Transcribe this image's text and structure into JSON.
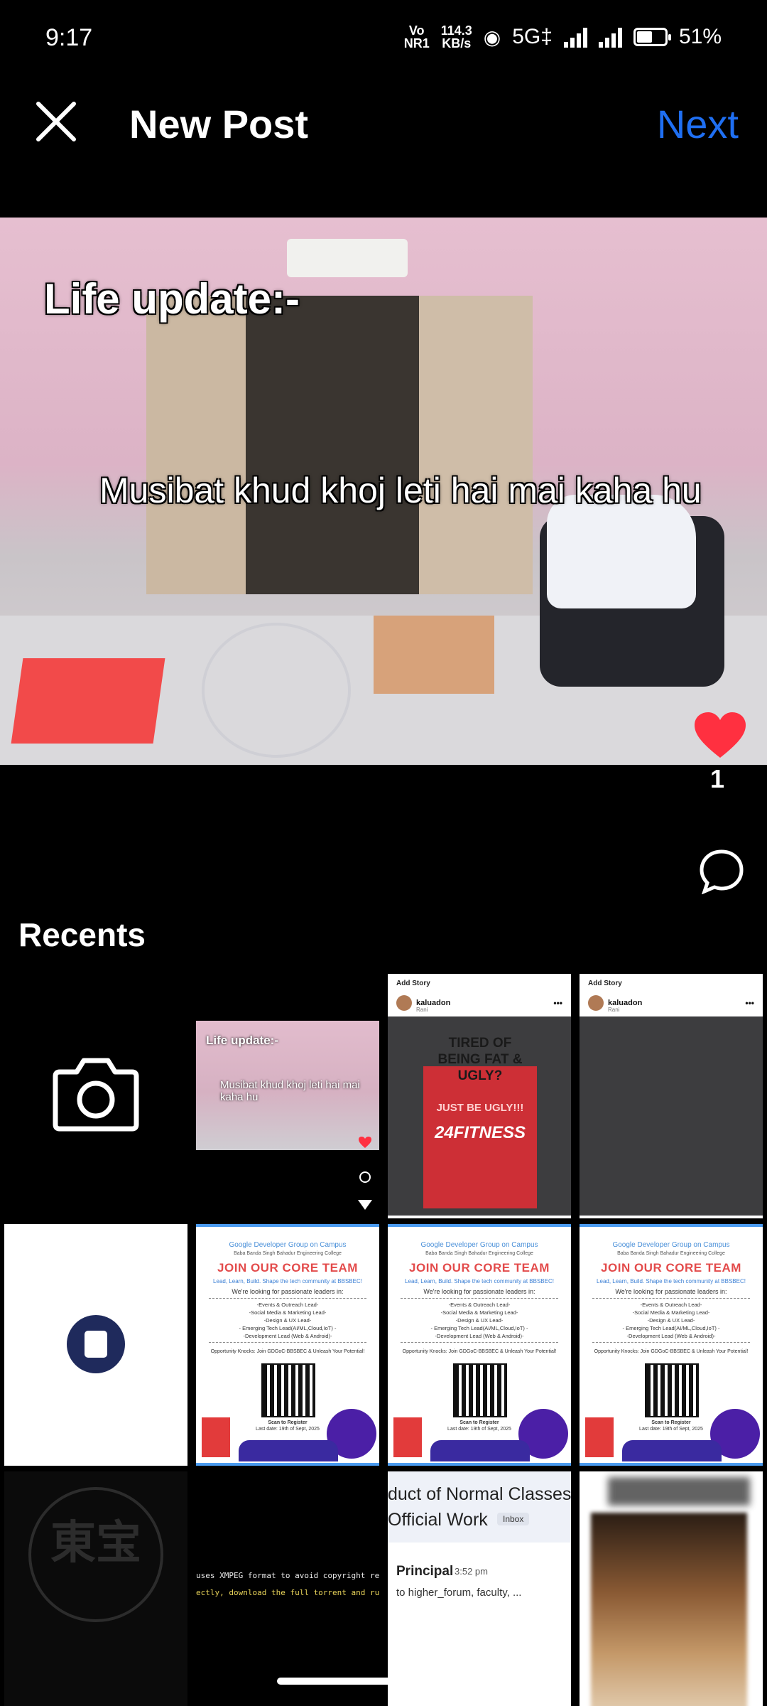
{
  "status_bar": {
    "time": "9:17",
    "volte": "Vo",
    "volte_sub": "NR1",
    "speed_value": "114.3",
    "speed_unit": "KB/s",
    "network": "5G‡",
    "battery": "51%",
    "battery_level": 0.51
  },
  "header": {
    "title": "New Post",
    "next_label": "Next",
    "close_icon": "close-icon"
  },
  "preview": {
    "caption_line1": "Life update:-",
    "caption_line2": "Musibat khud khoj leti hai mai kaha hu",
    "like_count": "1",
    "like_color": "#ff3040"
  },
  "recents": {
    "label": "Recents",
    "camera_icon": "camera-icon",
    "video_thumb": {
      "caption_line1": "Life update:-",
      "caption_line2": "Musibat khud khoj leti hai mai kaha hu"
    },
    "story1": {
      "top_label": "Add Story",
      "user": "kaluadon",
      "sub": "Rani",
      "sign_text": "TIRED OF BEING FAT & UGLY?",
      "sign_ugly": "JUST BE UGLY!!!",
      "sign_brand": "24FITNESS"
    },
    "story2": {
      "top_label": "Add Story",
      "user": "kaluadon",
      "sub": "Rani"
    },
    "poster": {
      "org": "Google Developer Group on Campus",
      "sub": "Baba Banda Singh Bahadur Engineering College",
      "title": "JOIN OUR CORE TEAM",
      "tagline": "Lead, Learn, Build. Shape the tech community at BBSBEC!",
      "looking": "We're looking for passionate leaders in:",
      "roles": [
        "-Events & Outreach Lead-",
        "-Social Media & Marketing Lead-",
        "-Design & UX Lead-",
        "- Emerging Tech Lead(AI/ML,Cloud,IoT) -",
        "-Development Lead (Web & Android)-"
      ],
      "opportunity": "Opportunity Knocks: Join GDGoC-BBSBEC & Unleash Your Potential!",
      "scan": "Scan to Register",
      "last_date": "Last date: 19th of Sept, 2025"
    },
    "dark_logo": {
      "glyph": "東宝"
    },
    "terminal": {
      "line1": "uses XMPEG format to avoid copyright re",
      "line2": "ectly, download the full torrent and ru"
    },
    "email": {
      "subject_line1": "duct of Normal Classes",
      "subject_line2": "Official Work",
      "badge": "Inbox",
      "sender": "Principal",
      "time": "3:52 pm",
      "to": "to higher_forum, faculty, ..."
    }
  }
}
